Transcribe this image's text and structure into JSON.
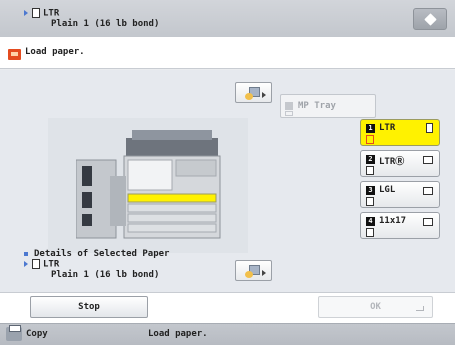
{
  "header": {
    "cube_icon": "cube-icon"
  },
  "message": {
    "text": "Load paper.",
    "icon": "paper-warning-icon",
    "accent": "#e44b1f"
  },
  "current_paper": {
    "size": "LTR",
    "type": "Plain 1 (16 lb bond)"
  },
  "mp_tray": {
    "label": "MP Tray"
  },
  "trays": [
    {
      "num": "1",
      "label": "LTR",
      "selected": true,
      "orient": "portrait"
    },
    {
      "num": "2",
      "label": "LTRⓇ",
      "selected": false,
      "orient": "landscape"
    },
    {
      "num": "3",
      "label": "LGL",
      "selected": false,
      "orient": "landscape"
    },
    {
      "num": "4",
      "label": "11x17",
      "selected": false,
      "orient": "landscape"
    }
  ],
  "legend": {
    "title": "Details of Selected Paper",
    "size": "LTR",
    "type": "Plain 1 (16 lb bond)"
  },
  "buttons": {
    "stop": "Stop",
    "ok": "OK"
  },
  "status": {
    "left": "Copy",
    "right": "Load paper."
  },
  "colors": {
    "highlight": "#fff200",
    "accent_blue": "#4c78d0"
  }
}
